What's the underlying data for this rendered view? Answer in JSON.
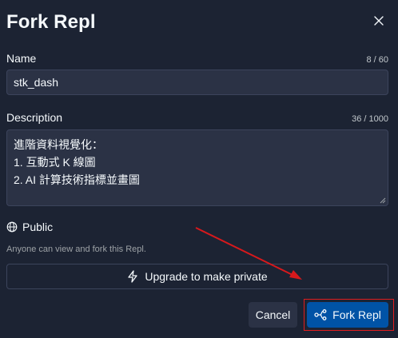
{
  "dialog": {
    "title": "Fork Repl",
    "close_icon": "close-icon"
  },
  "name_field": {
    "label": "Name",
    "counter": "8 / 60",
    "value": "stk_dash"
  },
  "description_field": {
    "label": "Description",
    "counter": "36 / 1000",
    "lines": [
      "進階資料視覺化：",
      "1. 互動式 K 線圖",
      "2. AI 計算技術指標並畫圖"
    ]
  },
  "visibility": {
    "icon": "globe-icon",
    "label": "Public",
    "hint": "Anyone can view and fork this Repl."
  },
  "upgrade": {
    "icon": "lightning-icon",
    "label": "Upgrade to make private"
  },
  "actions": {
    "cancel_label": "Cancel",
    "fork_icon": "fork-icon",
    "fork_label": "Fork Repl"
  },
  "annotation": {
    "arrow_color": "#d7191c",
    "box_color": "#e11d1d"
  },
  "colors": {
    "background": "#1c2333",
    "input_bg": "#2b3245",
    "primary": "#0053a6",
    "text": "#f5f9fc",
    "muted": "#9da2a6"
  }
}
